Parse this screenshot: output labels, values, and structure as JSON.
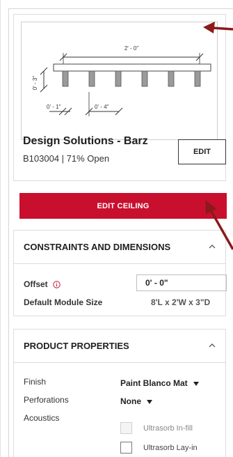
{
  "product": {
    "drawing": {
      "span_dim": "2' - 0\"",
      "height_dim": "0' - 3\"",
      "gap_dim": "0' - 1\"",
      "pitch_dim": "0' - 4\""
    },
    "name": "Design Solutions - Barz",
    "subtitle": "B103004  |  71% Open",
    "edit_label": "EDIT"
  },
  "actions": {
    "edit_ceiling_label": "EDIT CEILING"
  },
  "constraints": {
    "title": "CONSTRAINTS AND DIMENSIONS",
    "offset_label": "Offset",
    "offset_value": "0' - 0\"",
    "module_label": "Default Module Size",
    "module_value": "8'L x 2'W x 3\"D"
  },
  "properties": {
    "title": "PRODUCT PROPERTIES",
    "finish_label": "Finish",
    "finish_value": "Paint Blanco Mat",
    "perforations_label": "Perforations",
    "perforations_value": "None",
    "acoustics_label": "Acoustics",
    "acoustics_options": [
      {
        "label": "Ultrasorb In-fill",
        "enabled": false,
        "checked": false
      },
      {
        "label": "Ultrasorb Lay-in",
        "enabled": true,
        "checked": false
      }
    ]
  },
  "colors": {
    "accent": "#c8102e",
    "annotation_arrow": "#8b1a1a"
  }
}
